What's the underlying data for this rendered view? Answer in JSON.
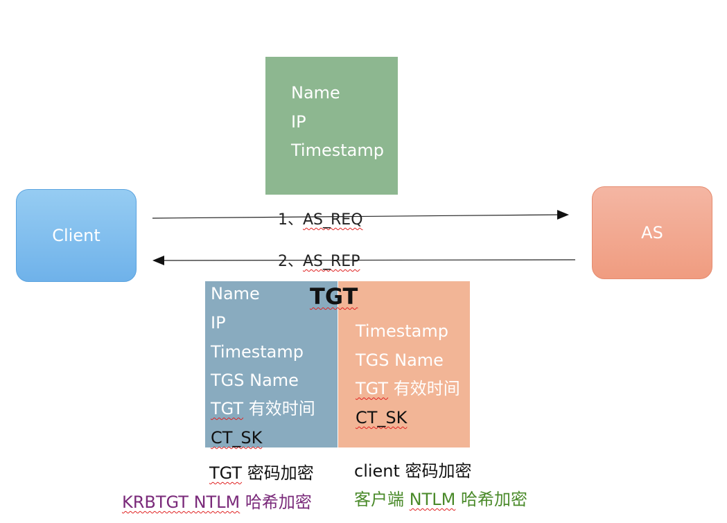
{
  "request_box": {
    "lines": [
      "Name",
      "IP",
      "Timestamp"
    ]
  },
  "client": {
    "label": "Client"
  },
  "as_node": {
    "label": "AS"
  },
  "arrows": {
    "request": {
      "prefix": "1、",
      "label": "AS_REQ"
    },
    "reply": {
      "prefix": "2、",
      "label": "AS_REP"
    }
  },
  "tgt": {
    "title": "TGT",
    "left_lines": [
      "Name",
      "IP",
      "Timestamp",
      "TGS Name"
    ],
    "left_validity": {
      "prefix": "TGT",
      "suffix": " 有效时间"
    },
    "left_key": "CT_SK",
    "right_lines": [
      "Timestamp",
      "TGS Name"
    ],
    "right_validity": {
      "prefix": "TGT",
      "suffix": " 有效时间"
    },
    "right_key": "CT_SK"
  },
  "captions": {
    "left_top": {
      "prefix": "TGT",
      "suffix": " 密码加密"
    },
    "left_bottom": {
      "prefix": "KRBTGT NTLM",
      "suffix": " 哈希加密"
    },
    "right_top": "client 密码加密",
    "right_bottom": {
      "prefix": "客户端 ",
      "mid": "NTLM",
      "suffix": " 哈希加密"
    }
  },
  "colors": {
    "request_box": "#8db790",
    "client": "#7fbdee",
    "as_node": "#f2a58b",
    "tgt_left": "#89abbf",
    "tgt_right": "#f2b596",
    "caption_purple": "#7a2a7a",
    "caption_green": "#4a8a2a"
  }
}
